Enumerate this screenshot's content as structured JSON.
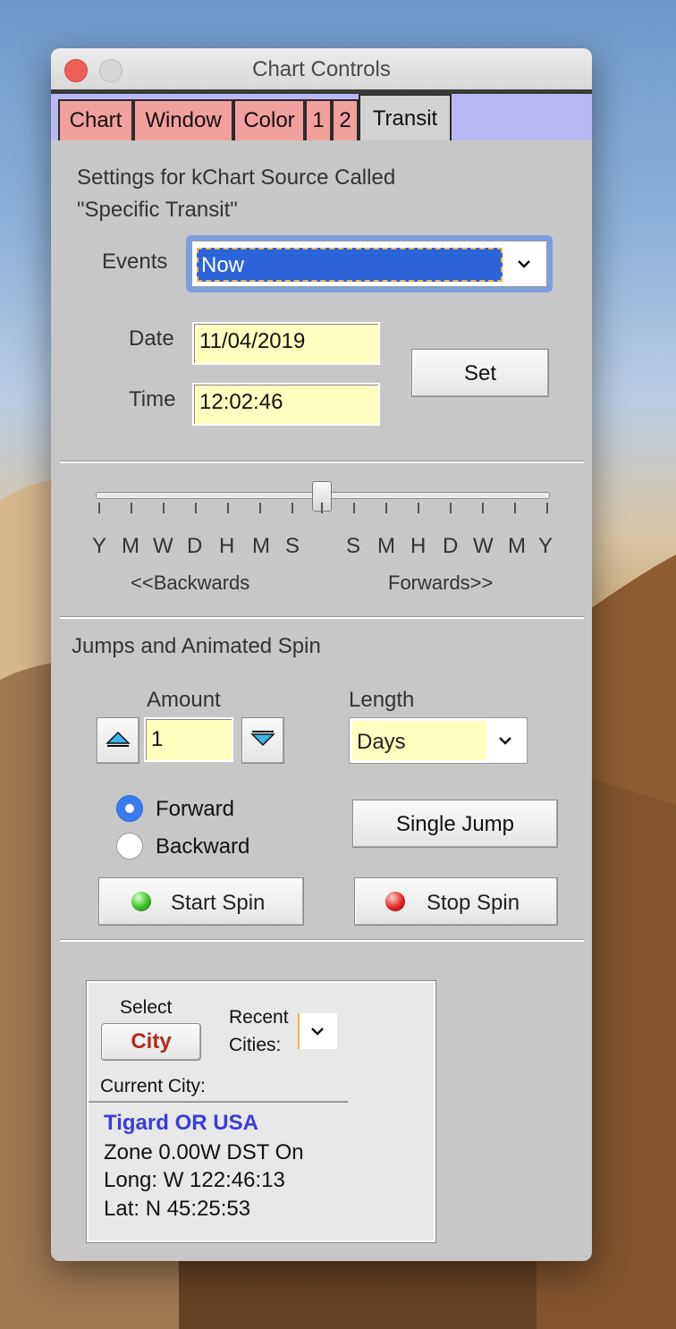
{
  "window": {
    "title": "Chart Controls"
  },
  "tabs": [
    "Chart",
    "Window",
    "Color",
    "1",
    "2",
    "Transit"
  ],
  "settings": {
    "heading_line1": "Settings for kChart Source Called",
    "heading_line2": "\"Specific Transit\"",
    "events_label": "Events",
    "events_value": "Now",
    "date_label": "Date",
    "date_value": "11/04/2019",
    "time_label": "Time",
    "time_value": "12:02:46",
    "set_button": "Set"
  },
  "slider": {
    "back_ticks": [
      "Y",
      "M",
      "W",
      "D",
      "H",
      "M",
      "S"
    ],
    "fwd_ticks": [
      "S",
      "M",
      "H",
      "D",
      "W",
      "M",
      "Y"
    ],
    "backwards_label": "<<Backwards",
    "forwards_label": "Forwards>>"
  },
  "jumps": {
    "heading": "Jumps and Animated Spin",
    "amount_label": "Amount",
    "amount_value": "1",
    "length_label": "Length",
    "length_value": "Days",
    "forward_label": "Forward",
    "backward_label": "Backward",
    "direction_selected": "Forward",
    "single_jump_button": "Single Jump",
    "start_spin_button": "Start Spin",
    "stop_spin_button": "Stop Spin"
  },
  "city": {
    "select_label": "Select",
    "city_button": "City",
    "recent_label_line1": "Recent",
    "recent_label_line2": "Cities:",
    "current_city_label": "Current City:",
    "name": "Tigard OR USA",
    "zone": "Zone 0.00W  DST On",
    "longitude": "Long: W 122:46:13",
    "latitude": "Lat: N 45:25:53"
  },
  "colors": {
    "tab_bg": "#f2a09c",
    "tab_strip": "#b8b8f2",
    "field_bg": "#ffffbf",
    "select_highlight": "#2d63d8",
    "city_name": "#3b3bdc",
    "city_button_text": "#b52a1a"
  }
}
